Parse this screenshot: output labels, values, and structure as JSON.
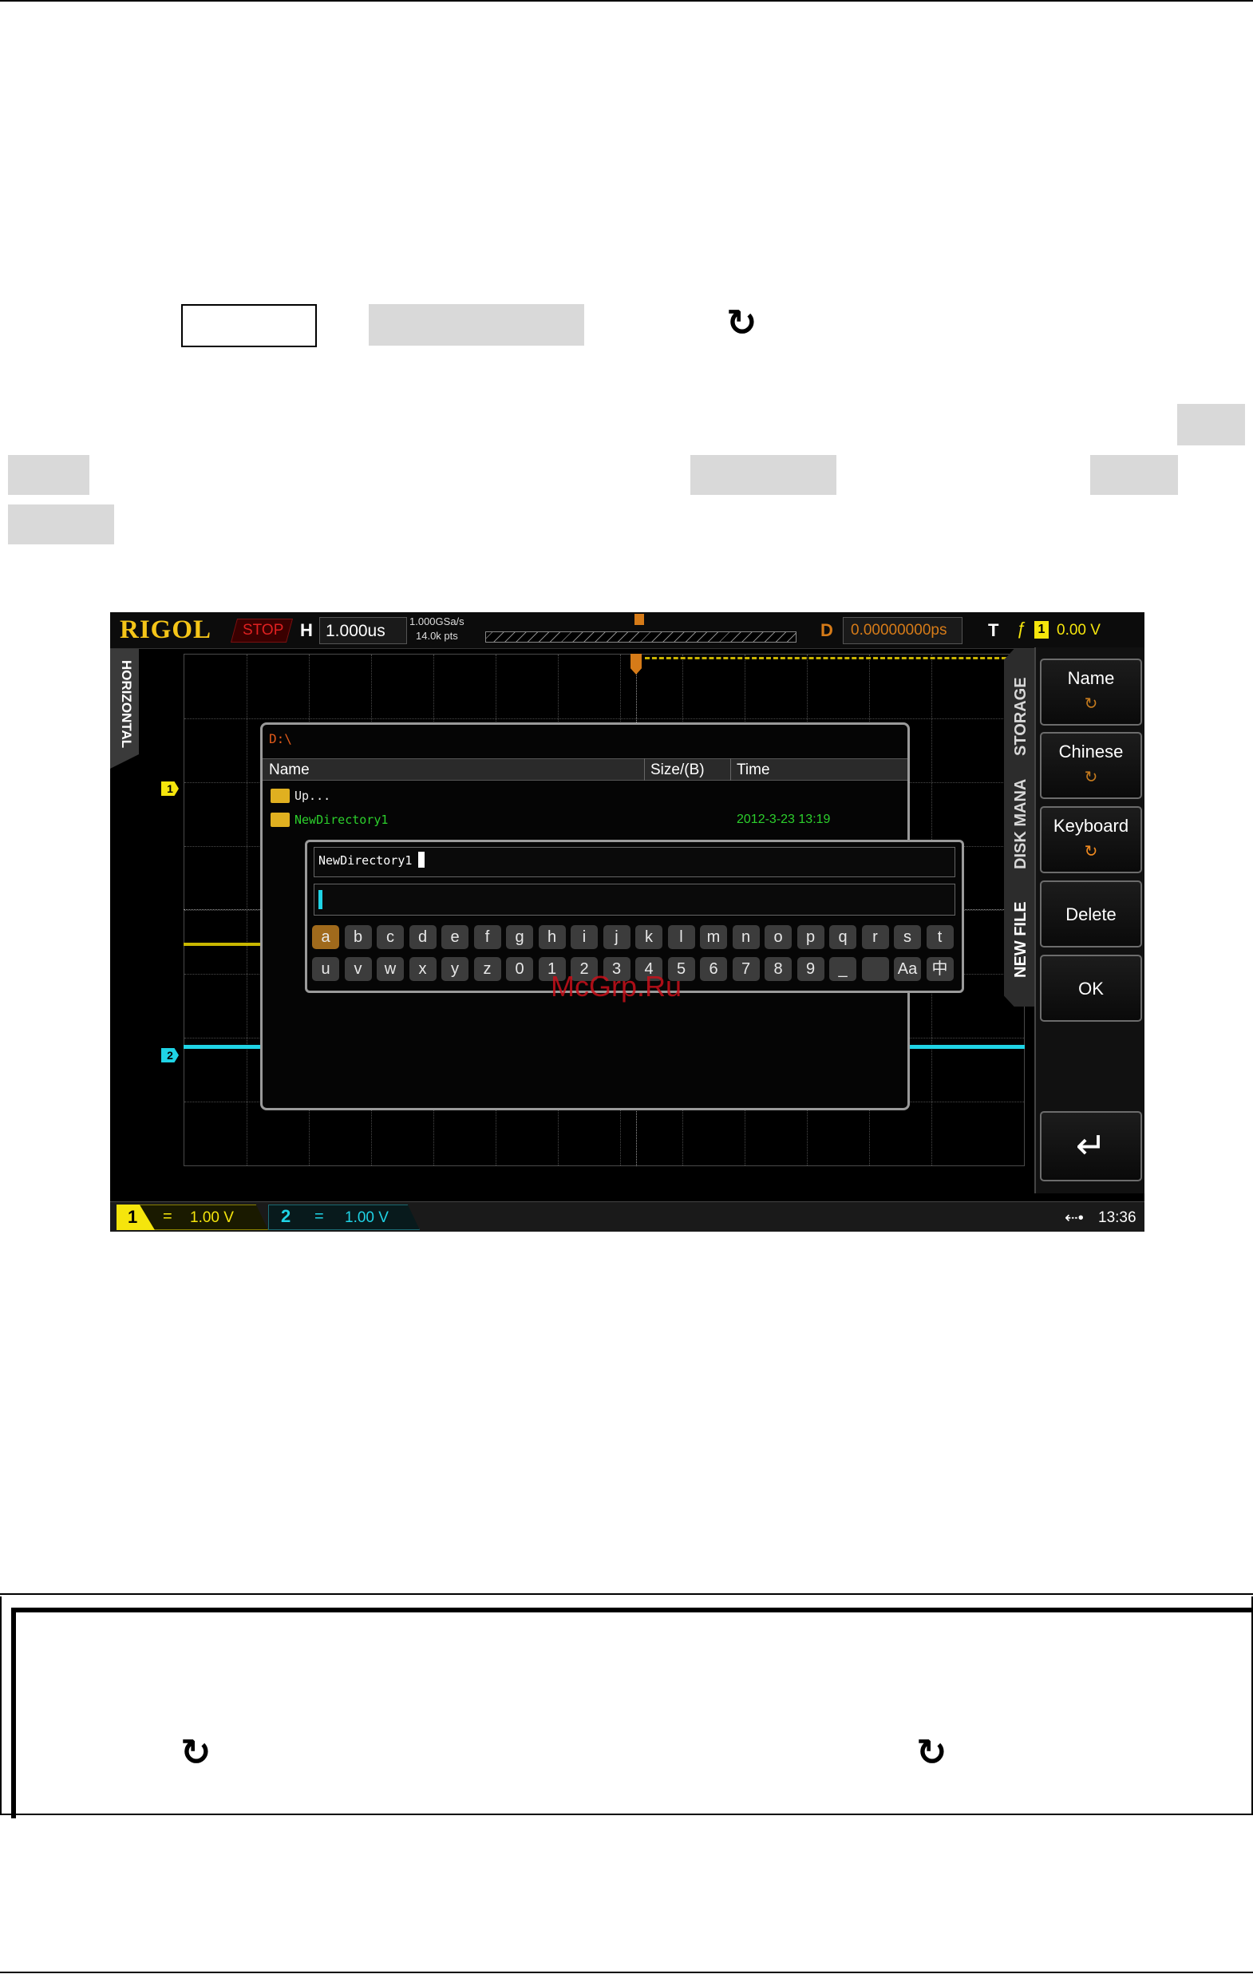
{
  "scope": {
    "brand": "RIGOL",
    "run_state": "STOP",
    "h_label": "H",
    "timebase": "1.000us",
    "sample_rate": "1.000GSa/s",
    "memory_depth": "14.0k pts",
    "delay_label": "D",
    "delay_value": "0.00000000ps",
    "trigger_label": "T",
    "trigger_channel": "1",
    "trigger_level": "0.00 V",
    "horizontal_tab": "HORIZONTAL",
    "ch1_marker": "1",
    "ch2_marker": "2",
    "file_dialog": {
      "path": "D:\\",
      "columns": [
        "Name",
        "Size/(B)",
        "Time"
      ],
      "rows": [
        {
          "name": "Up...",
          "size": "",
          "time": ""
        },
        {
          "name": "NewDirectory1",
          "size": "",
          "time": "2012-3-23 13:19"
        }
      ]
    },
    "keyboard": {
      "name_field": "NewDirectory1",
      "row1": [
        "a",
        "b",
        "c",
        "d",
        "e",
        "f",
        "g",
        "h",
        "i",
        "j",
        "k",
        "l",
        "m",
        "n",
        "o",
        "p",
        "q",
        "r",
        "s",
        "t"
      ],
      "row2": [
        "u",
        "v",
        "w",
        "x",
        "y",
        "z",
        "0",
        "1",
        "2",
        "3",
        "4",
        "5",
        "6",
        "7",
        "8",
        "9",
        "_",
        "",
        "Aa",
        "中"
      ]
    },
    "watermark": "McGrp.Ru",
    "side_tabs": [
      "STORAGE",
      "DISK MANA",
      "NEW FILE"
    ],
    "softkeys": [
      {
        "label": "Name",
        "knob": "↻"
      },
      {
        "label": "Chinese",
        "knob": "↻"
      },
      {
        "label": "Keyboard",
        "knob": "↻"
      },
      {
        "label": "Delete"
      },
      {
        "label": "OK"
      },
      {
        "label": "↵"
      }
    ],
    "status": {
      "ch1_num": "1",
      "ch1_coupling": "=",
      "ch1_scale": "1.00 V",
      "ch2_num": "2",
      "ch2_coupling": "=",
      "ch2_scale": "1.00 V",
      "usb_icon": "usb-icon",
      "clock": "13:36"
    }
  },
  "page": {
    "knob_symbol": "↻"
  },
  "colors": {
    "ch1": "#f5e50c",
    "ch2": "#1fd3e5",
    "brand": "#f5c518",
    "accent": "#c47a1e",
    "dir_green": "#2ccf2c"
  }
}
